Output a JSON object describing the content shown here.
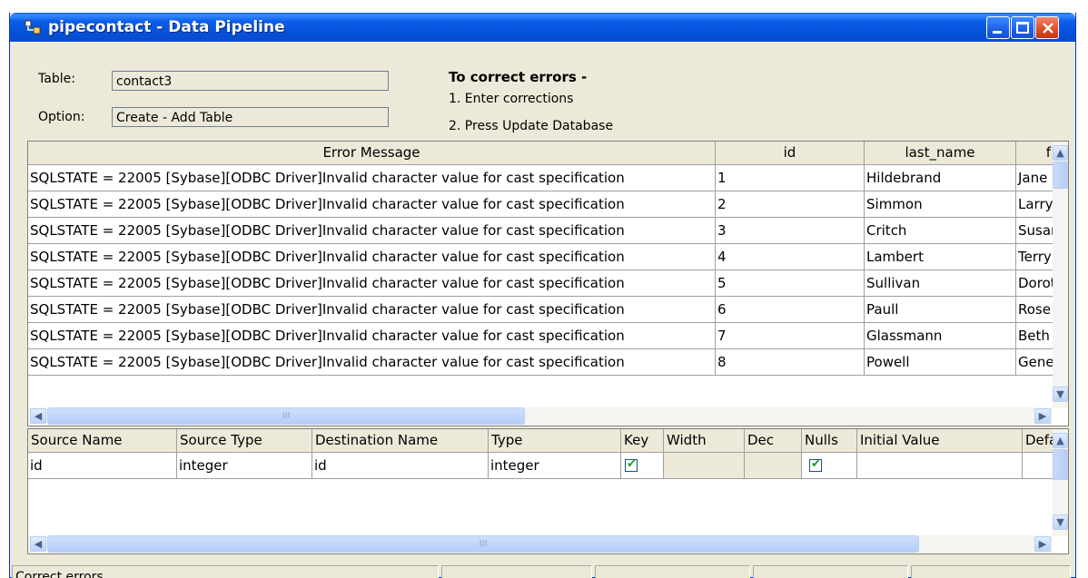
{
  "window": {
    "title": "pipecontact - Data Pipeline"
  },
  "info": {
    "table_label": "Table:",
    "table_value": "contact3",
    "option_label": "Option:",
    "option_value": "Create - Add Table",
    "instructions_title": "To correct errors -",
    "instruction_1": "1. Enter corrections",
    "instruction_2": "2. Press Update Database"
  },
  "error_grid": {
    "headers": [
      "Error Message",
      "id",
      "last_name",
      "f"
    ],
    "rows": [
      {
        "error": "SQLSTATE = 22005  [Sybase][ODBC Driver]Invalid character value for cast specification",
        "id": "1",
        "last_name": "Hildebrand",
        "first": "Jane"
      },
      {
        "error": "SQLSTATE = 22005  [Sybase][ODBC Driver]Invalid character value for cast specification",
        "id": "2",
        "last_name": "Simmon",
        "first": "Larry"
      },
      {
        "error": "SQLSTATE = 22005  [Sybase][ODBC Driver]Invalid character value for cast specification",
        "id": "3",
        "last_name": "Critch",
        "first": "Susar"
      },
      {
        "error": "SQLSTATE = 22005  [Sybase][ODBC Driver]Invalid character value for cast specification",
        "id": "4",
        "last_name": "Lambert",
        "first": "Terry"
      },
      {
        "error": "SQLSTATE = 22005  [Sybase][ODBC Driver]Invalid character value for cast specification",
        "id": "5",
        "last_name": "Sullivan",
        "first": "Dorot"
      },
      {
        "error": "SQLSTATE = 22005  [Sybase][ODBC Driver]Invalid character value for cast specification",
        "id": "6",
        "last_name": "Paull",
        "first": "Rose"
      },
      {
        "error": "SQLSTATE = 22005  [Sybase][ODBC Driver]Invalid character value for cast specification",
        "id": "7",
        "last_name": "Glassmann",
        "first": "Beth"
      },
      {
        "error": "SQLSTATE = 22005  [Sybase][ODBC Driver]Invalid character value for cast specification",
        "id": "8",
        "last_name": "Powell",
        "first": "Gene"
      }
    ]
  },
  "column_grid": {
    "headers": [
      "Source Name",
      "Source Type",
      "Destination Name",
      "Type",
      "Key",
      "Width",
      "Dec",
      "Nulls",
      "Initial Value",
      "Defa"
    ],
    "rows": [
      {
        "source_name": "id",
        "source_type": "integer",
        "destination_name": "id",
        "type": "integer",
        "key": true,
        "width": "",
        "dec": "",
        "nulls": true,
        "initial_value": "",
        "default": ""
      }
    ]
  },
  "statusbar": {
    "text": "Correct errors"
  },
  "colors": {
    "titlebar": "#0a5ee6",
    "window_bg": "#ece9d8",
    "close_button": "#de4b25"
  }
}
